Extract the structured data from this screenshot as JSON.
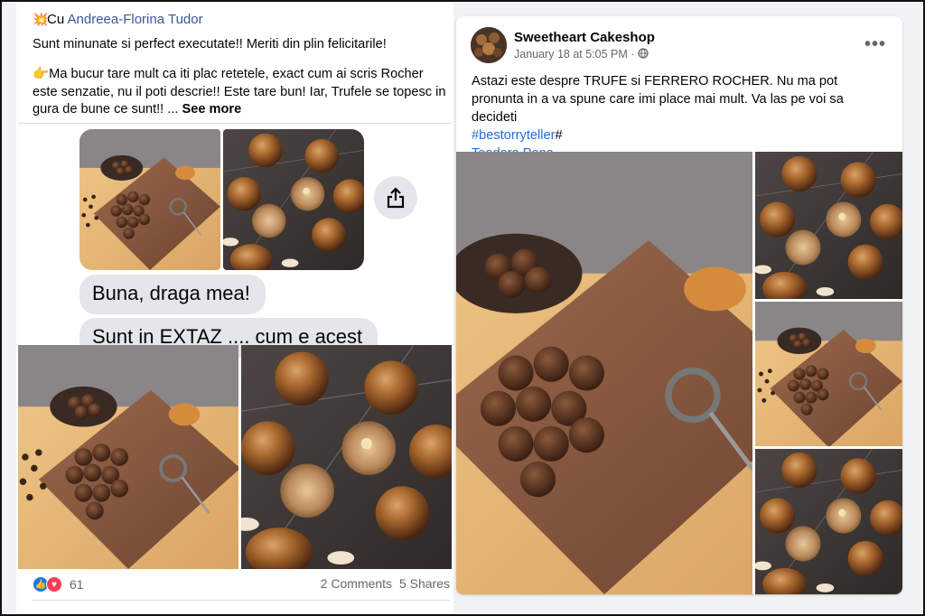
{
  "left_post": {
    "tag_emoji": "💥",
    "tag_prefix": "Cu ",
    "tag_user": "Andreea-Florina Tudor",
    "line1": "Sunt minunate si perfect executate!! Meriti din plin felicitarile!",
    "line2_emoji": "👉",
    "line2": "Ma bucur tare mult ca iti plac retetele, exact cum ai scris Rocher este senzatie, nu il poti descrie!! Este tare bun! Iar, Trufele se topesc in gura de bune ce sunt!! ...",
    "see_more": "See more",
    "bubble1": "Buna, draga mea!",
    "bubble2": "Sunt in EXTAZ .... cum e acest",
    "reaction_count": "61",
    "comments": "2 Comments",
    "shares": "5 Shares"
  },
  "right_post": {
    "page_name": "Sweetheart Cakeshop",
    "date": "January 18 at 5:05 PM",
    "dot": "·",
    "more": "•••",
    "text": "Astazi este despre TRUFE si  FERRERO ROCHER. Nu ma pot pronunta in a va spune care imi place mai mult. Va las pe voi sa decideti",
    "hashtag": "#bestorryteller",
    "hash_suffix": "#",
    "tagged": "Teodora Pana"
  },
  "icons": {
    "share": "share-icon",
    "globe": "globe-icon",
    "like": "like-reaction-icon",
    "love": "love-reaction-icon"
  },
  "colors": {
    "link": "#385898",
    "hashtag": "#216fdb",
    "like": "#1877f2",
    "love": "#f33e58",
    "background": "#f0f2f5"
  }
}
